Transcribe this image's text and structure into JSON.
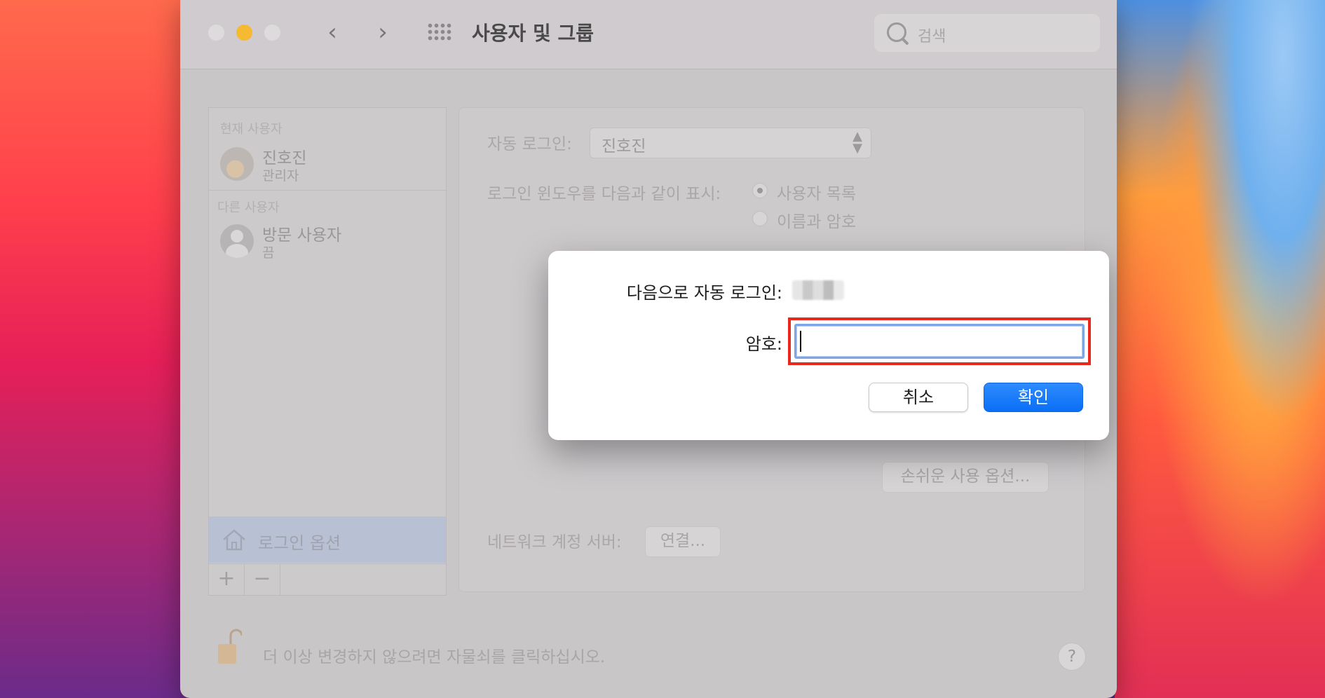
{
  "window": {
    "title": "사용자 및 그룹",
    "search_placeholder": "검색"
  },
  "sidebar": {
    "current_users_header": "현재 사용자",
    "current_user": {
      "name": "진호진",
      "role": "관리자"
    },
    "other_users_header": "다른 사용자",
    "guest_user": {
      "name": "방문 사용자",
      "status": "끔"
    },
    "login_options_label": "로그인 옵션",
    "add_label": "+",
    "remove_label": "−"
  },
  "panel": {
    "auto_login_label": "자동 로그인:",
    "auto_login_value": "진호진",
    "display_window_label": "로그인 윈도우를 다음과 같이 표시:",
    "radio_user_list": "사용자 목록",
    "radio_name_password": "이름과 암호",
    "accessibility_button": "손쉬운 사용 옵션...",
    "network_server_label": "네트워크 계정 서버:",
    "connect_button": "연결..."
  },
  "footer": {
    "lock_text": "더 이상 변경하지 않으려면 자물쇠를 클릭하십시오.",
    "help_label": "?"
  },
  "dialog": {
    "auto_login_label": "다음으로 자동 로그인:",
    "password_label": "암호:",
    "password_value": "",
    "cancel_label": "취소",
    "ok_label": "확인"
  },
  "colors": {
    "accent": "#0a6ff5",
    "highlight_box": "#e8271d",
    "traffic_minimize": "#f5b932"
  }
}
